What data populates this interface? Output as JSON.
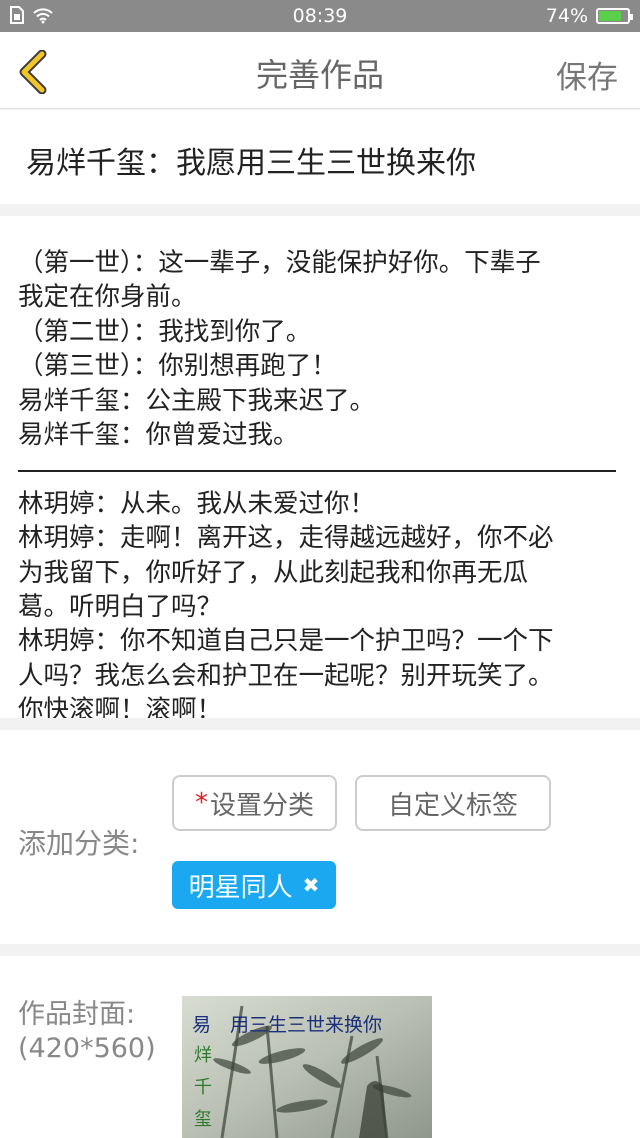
{
  "status": {
    "time": "08:39",
    "battery": "74%",
    "battery_level": 0.74
  },
  "nav": {
    "title": "完善作品",
    "save": "保存"
  },
  "work_title": "易烊千玺：我愿用三生三世换来你",
  "body": {
    "lines_before_divider": [
      "（第一世）：这一辈子，没能保护好你。下辈子",
      "我定在你身前。",
      "（第二世）：我找到你了。",
      "（第三世）：你别想再跑了！",
      "易烊千玺：公主殿下我来迟了。",
      "易烊千玺：你曾爱过我。"
    ],
    "lines_after_divider": [
      "林玥婷：从未。我从未爱过你！",
      "林玥婷：走啊！离开这，走得越远越好，你不必",
      "为我留下，你听好了，从此刻起我和你再无瓜",
      "葛。听明白了吗？",
      "林玥婷：你不知道自己只是一个护卫吗？一个下",
      "人吗？我怎么会和护卫在一起呢？别开玩笑了。",
      "你快滚啊！滚啊！"
    ]
  },
  "category": {
    "label": "添加分类:",
    "required_mark": "*",
    "set_category": "设置分类",
    "custom_tag": "自定义标签",
    "selected_tag": "明星同人",
    "accent": "#1aa9f0"
  },
  "cover": {
    "label_line1": "作品封面:",
    "label_line2": "(420*560)",
    "image_text": "易　用三生三世来换你",
    "image_vertical": [
      "烊",
      "千",
      "玺"
    ]
  }
}
